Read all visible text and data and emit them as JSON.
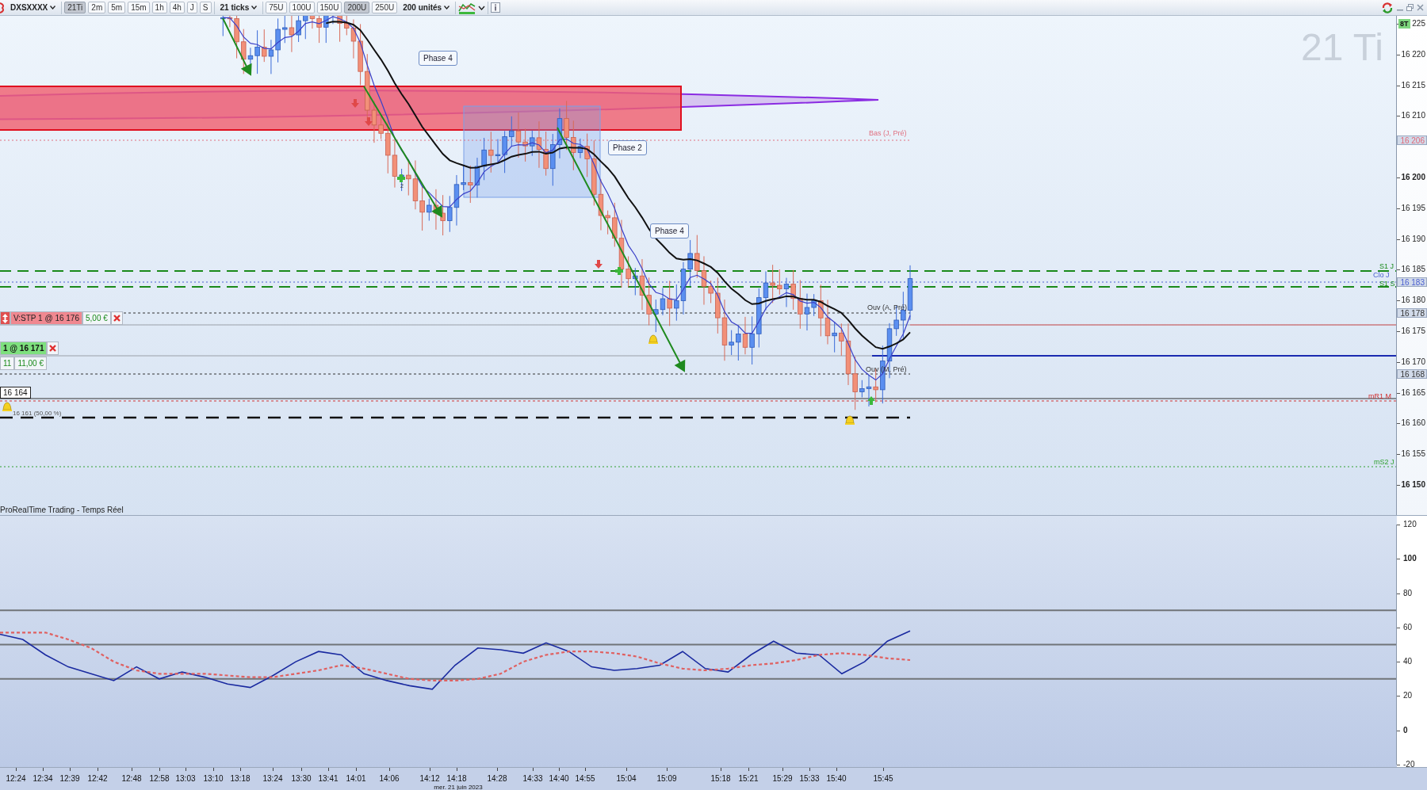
{
  "toolbar": {
    "instrument": "DXSXXXX",
    "periods": [
      {
        "label": "21Ti",
        "selected": true
      },
      {
        "label": "2m",
        "selected": false
      },
      {
        "label": "5m",
        "selected": false
      },
      {
        "label": "15m",
        "selected": false
      },
      {
        "label": "1h",
        "selected": false
      },
      {
        "label": "4h",
        "selected": false
      },
      {
        "label": "J",
        "selected": false
      },
      {
        "label": "S",
        "selected": false
      }
    ],
    "ticks": "21 ticks",
    "units": [
      {
        "label": "75U",
        "selected": false
      },
      {
        "label": "100U",
        "selected": false
      },
      {
        "label": "150U",
        "selected": false
      },
      {
        "label": "200U",
        "selected": true
      },
      {
        "label": "250U",
        "selected": false
      }
    ],
    "unit_count": "200 unités"
  },
  "price_chart": {
    "title": "21 Ti",
    "bar_count": "8T",
    "price_axis": [
      "225",
      "16 220",
      "16 215",
      "16 210",
      "16 200",
      "16 195",
      "16 190",
      "16 185",
      "16 180",
      "16 175",
      "16 170",
      "16 165",
      "16 160",
      "16 155",
      "16 150"
    ],
    "axis_markers": [
      {
        "label": "16 206",
        "color": "#e06878"
      },
      {
        "label": "16 183",
        "color": "#4a5ed0"
      },
      {
        "label": "16 178",
        "color": "#333333"
      },
      {
        "label": "16 168",
        "color": "#333333"
      }
    ],
    "level_labels": [
      "Bas (J, Pré)",
      "S1 J",
      "Clo J",
      "S1 S",
      "Ouv (A, Pré)",
      "Ouv (M, Pré)",
      "mR1 M",
      "mS2 J"
    ],
    "phases": [
      "Phase 4",
      "Phase 2",
      "Phase 4"
    ],
    "marker_count": "2",
    "orders": [
      {
        "kind": "stop",
        "label": "V:STP 1 @ 16 176",
        "amount": "5,00 €"
      },
      {
        "kind": "position",
        "label": "1 @ 16 171",
        "quantity": "11",
        "amount": "11,00 €"
      }
    ],
    "alert_price": "16 164",
    "retracement": "16 161 (50,00 %)"
  },
  "indicator": {
    "title": "ProRealTime Trading - Temps Réel",
    "chart_data": {
      "type": "line",
      "ylim": [
        -20,
        120
      ],
      "yticks": [
        {
          "value": 120,
          "label": "120"
        },
        {
          "value": 100,
          "label": "100"
        },
        {
          "value": 80,
          "label": "80"
        },
        {
          "value": 60,
          "label": "60"
        },
        {
          "value": 40,
          "label": "40"
        },
        {
          "value": 20,
          "label": "20"
        },
        {
          "value": 0,
          "label": "0"
        },
        {
          "value": -20,
          "label": "-20"
        }
      ],
      "series": [
        {
          "color": "#1a2aa0",
          "line_style": "solid",
          "values": [
            56,
            53,
            44,
            37,
            33,
            29,
            37,
            30,
            34,
            31,
            27,
            25,
            32,
            40,
            46,
            44,
            33,
            29,
            26,
            24,
            38,
            48,
            47,
            45,
            51,
            46,
            37,
            35,
            36,
            38,
            46,
            36,
            34,
            44,
            52,
            45,
            44,
            33,
            40,
            52,
            58
          ]
        },
        {
          "color": "#e06060",
          "line_style": "dashed",
          "values": [
            57,
            57,
            57,
            53,
            48,
            40,
            35,
            33,
            33,
            33,
            32,
            31,
            31,
            33,
            35,
            38,
            36,
            33,
            30,
            29,
            29,
            30,
            33,
            40,
            44,
            46,
            46,
            45,
            43,
            39,
            36,
            35,
            36,
            38,
            39,
            41,
            44,
            45,
            44,
            42,
            41
          ]
        }
      ]
    }
  },
  "time_axis": {
    "labels": [
      "12:24",
      "12:34",
      "12:39",
      "12:42",
      "12:48",
      "12:58",
      "13:03",
      "13:10",
      "13:18",
      "13:24",
      "13:30",
      "13:41",
      "14:01",
      "14:06",
      "14:12",
      "14:18",
      "14:28",
      "14:33",
      "14:40",
      "14:55",
      "15:04",
      "15:09",
      "15:18",
      "15:21",
      "15:29",
      "15:33",
      "15:40",
      "15:45"
    ],
    "date": "mer. 21 juin 2023"
  }
}
